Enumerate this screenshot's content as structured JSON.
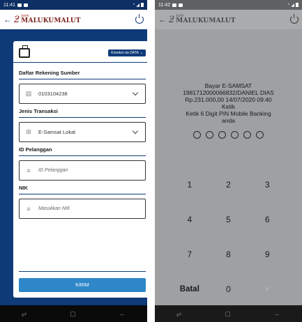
{
  "left": {
    "status": {
      "time": "11:41"
    },
    "brand": {
      "small": "bank",
      "main": "MALUKUMALUT"
    },
    "connection": "Koneksi via DATA",
    "fields": [
      {
        "label": "Daftar Rekening Sumber",
        "value": "0103104238"
      },
      {
        "label": "Jenis Transaksi",
        "value": "E-Samsat Lokal"
      },
      {
        "label": "ID Pelanggan",
        "placeholder": "ID Pelanggan"
      },
      {
        "label": "NIK",
        "placeholder": "Masukkan NIK"
      }
    ],
    "submit": "KIRIM"
  },
  "right": {
    "status": {
      "time": "11:42"
    },
    "brand": {
      "small": "bank",
      "main": "MALUKUMALUT"
    },
    "info": {
      "line1": "Bayar E-SAMSAT",
      "line2": "1981712000066832/DANIEL DIAS",
      "line3": "Rp.231.000,00  14/07/2020 09:40",
      "line4": "Ketik",
      "line5": "Ketik 6 Digit PIN Mobile Banking",
      "line6": "anda"
    },
    "keys": [
      "1",
      "2",
      "3",
      "4",
      "5",
      "6",
      "7",
      "8",
      "9",
      "Batal",
      "0",
      "×"
    ]
  }
}
